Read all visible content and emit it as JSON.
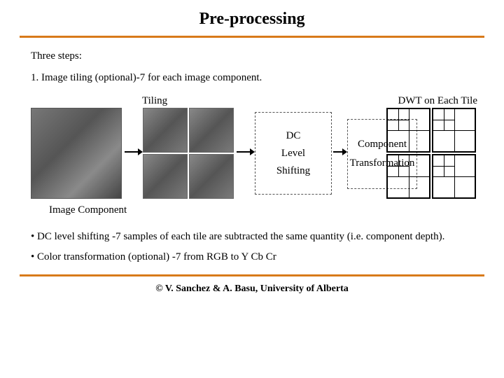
{
  "title": "Pre-processing",
  "intro": "Three steps:",
  "step1": "1. Image tiling (optional)-7 for each image component.",
  "labels": {
    "tiling": "Tiling",
    "imagecomponent": "Image Component",
    "dwt": "DWT on Each Tile"
  },
  "box1": {
    "l1": "DC",
    "l2": "Level",
    "l3": "Shifting"
  },
  "box2": {
    "l1": "Component",
    "l2": "Transformation"
  },
  "bullet1": "• DC level shifting -7 samples of each tile are subtracted the same quantity (i.e. component depth).",
  "bullet2": "• Color transformation (optional) -7 from RGB to Y Cb Cr",
  "footer": "© V. Sanchez & A. Basu, University of Alberta"
}
